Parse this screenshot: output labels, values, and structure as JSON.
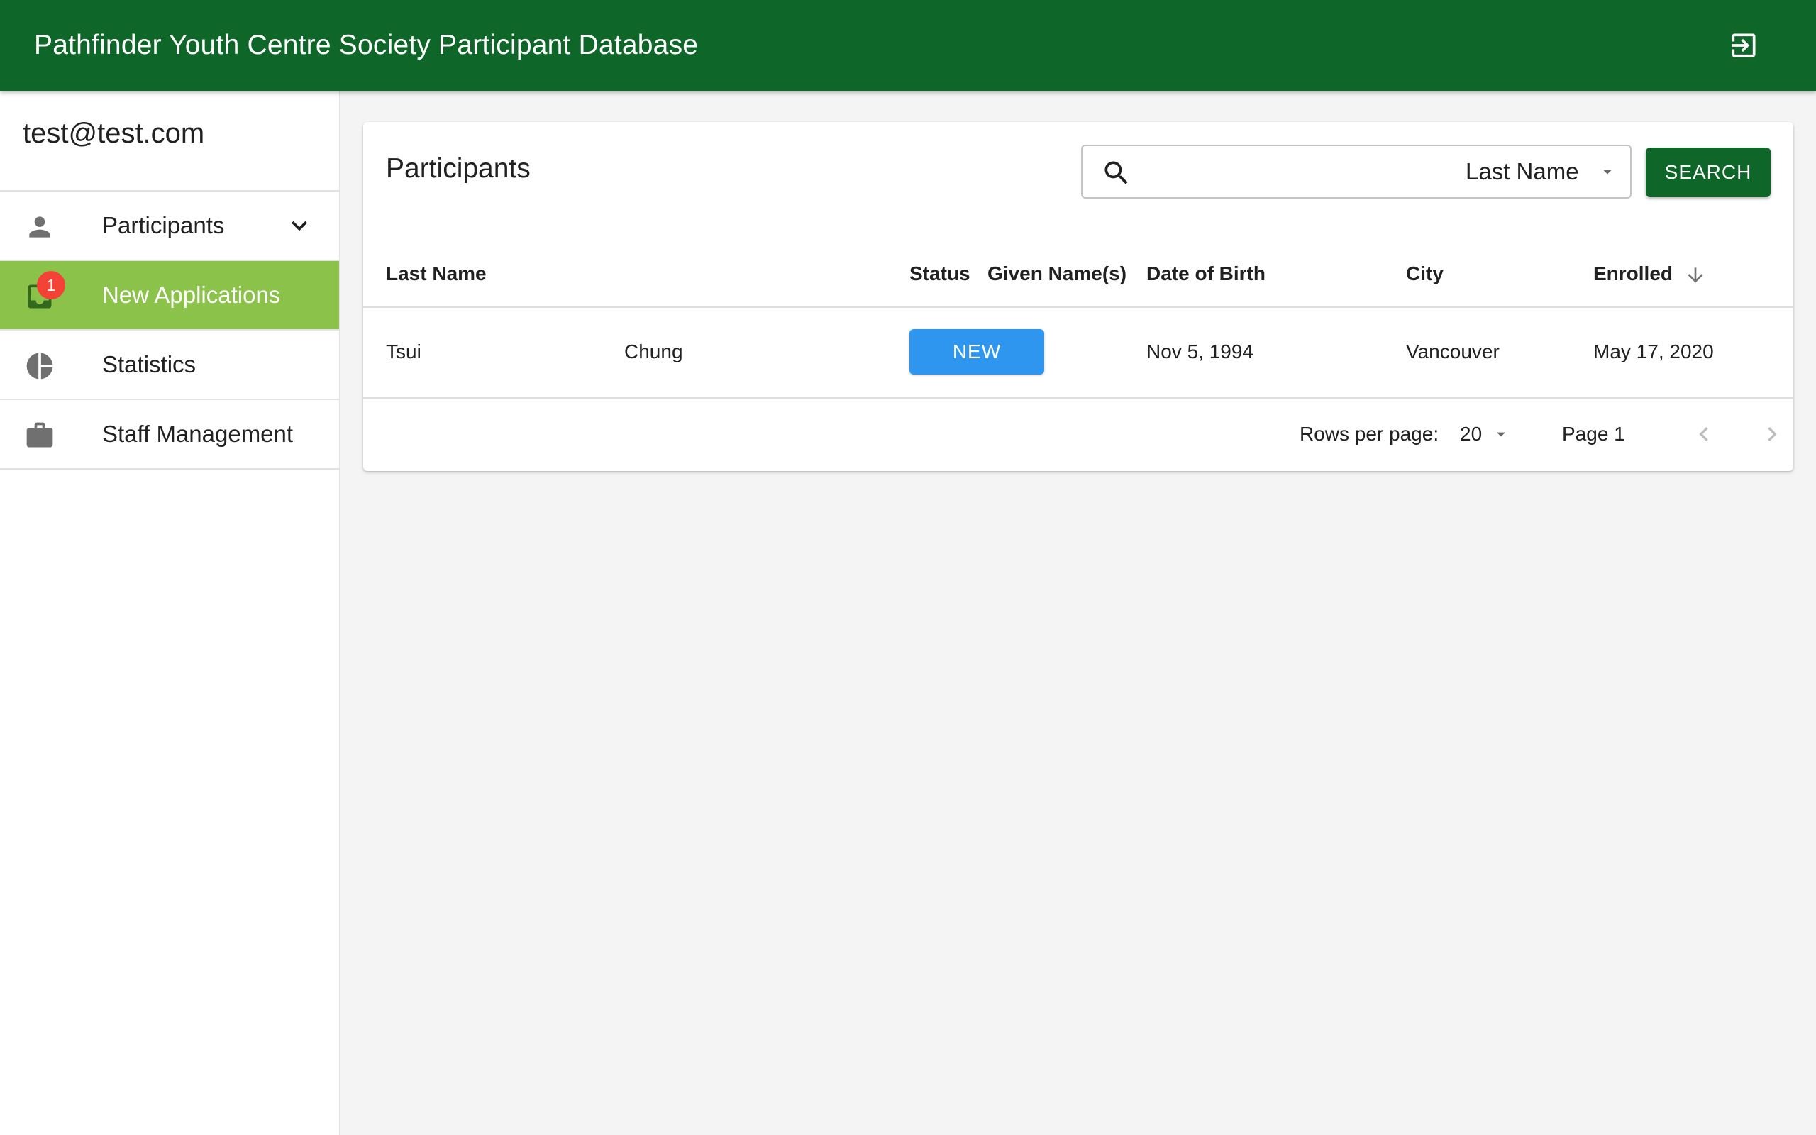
{
  "appbar": {
    "title": "Pathfinder Youth Centre Society Participant Database",
    "logout_icon": "logout-icon"
  },
  "sidebar": {
    "user_email": "test@test.com",
    "items": [
      {
        "label": "Participants",
        "icon": "person-icon",
        "expandable": true
      },
      {
        "label": "New Applications",
        "icon": "inbox-icon",
        "badge": "1",
        "active": true
      },
      {
        "label": "Statistics",
        "icon": "pie-chart-icon"
      },
      {
        "label": "Staff Management",
        "icon": "briefcase-icon"
      }
    ]
  },
  "main": {
    "title": "Participants",
    "search": {
      "placeholder": "",
      "value": "",
      "field_select": "Last Name",
      "button_label": "SEARCH"
    },
    "table": {
      "columns": [
        "Last Name",
        "Given Name(s)",
        "Status",
        "Date of Birth",
        "City",
        "Enrolled"
      ],
      "sorted_column": "Enrolled",
      "sort_direction": "descending",
      "rows": [
        {
          "last_name": "Tsui",
          "given_names": "Chung",
          "status": "NEW",
          "date_of_birth": "Nov 5, 1994",
          "city": "Vancouver",
          "enrolled": "May 17, 2020"
        }
      ]
    },
    "pagination": {
      "rows_per_page_label": "Rows per page:",
      "rows_per_page": "20",
      "page_label": "Page 1"
    }
  },
  "colors": {
    "appbar": "#0e6629",
    "active_nav": "#8bc34a",
    "status_new": "#2f96f0",
    "badge": "#f44336",
    "search_button": "#0e6629"
  }
}
